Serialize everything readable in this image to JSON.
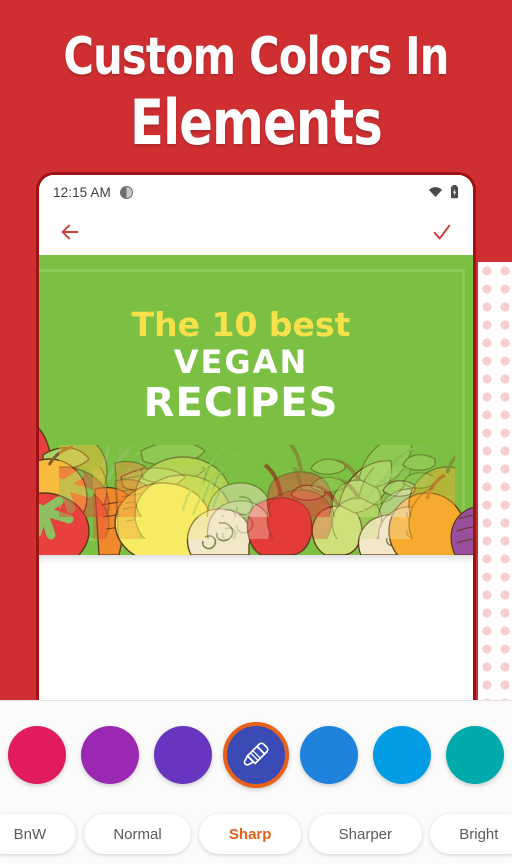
{
  "promo": {
    "line1": "Custom Colors In",
    "line2": "Elements",
    "background_color": "#d02f32"
  },
  "phone": {
    "status_bar": {
      "time": "12:15 AM",
      "dnd_icon": "half-circle-icon",
      "wifi_icon": "wifi-icon",
      "battery_icon": "battery-charging-icon"
    },
    "app_bar": {
      "back_icon": "back-arrow-icon",
      "confirm_icon": "checkmark-icon",
      "icon_color": "#d0393c"
    }
  },
  "poster": {
    "line1": "The 10 best",
    "line2": "VEGAN",
    "line3": "RECIPES",
    "bg_color": "#7cc043",
    "accent_color": "#f7e14a",
    "text_color": "#ffffff"
  },
  "color_picker": {
    "swatches": [
      {
        "name": "crimson",
        "color": "#e21b5f",
        "selected": false,
        "icon": ""
      },
      {
        "name": "purple",
        "color": "#9b28b3",
        "selected": false,
        "icon": ""
      },
      {
        "name": "deep-purple",
        "color": "#6735c0",
        "selected": false,
        "icon": ""
      },
      {
        "name": "indigo",
        "color": "#3a4bb5",
        "selected": true,
        "icon": "eyedropper-icon"
      },
      {
        "name": "blue",
        "color": "#1f82dd",
        "selected": false,
        "icon": ""
      },
      {
        "name": "light-blue",
        "color": "#039ce5",
        "selected": false,
        "icon": ""
      },
      {
        "name": "teal",
        "color": "#00aaaa",
        "selected": false,
        "icon": ""
      }
    ],
    "selection_ring_color": "#e8601a"
  },
  "filters": {
    "items": [
      {
        "label": "BnW",
        "active": false
      },
      {
        "label": "Normal",
        "active": false
      },
      {
        "label": "Sharp",
        "active": true
      },
      {
        "label": "Sharper",
        "active": false
      },
      {
        "label": "Bright",
        "active": false
      }
    ],
    "active_color": "#e8601a"
  }
}
